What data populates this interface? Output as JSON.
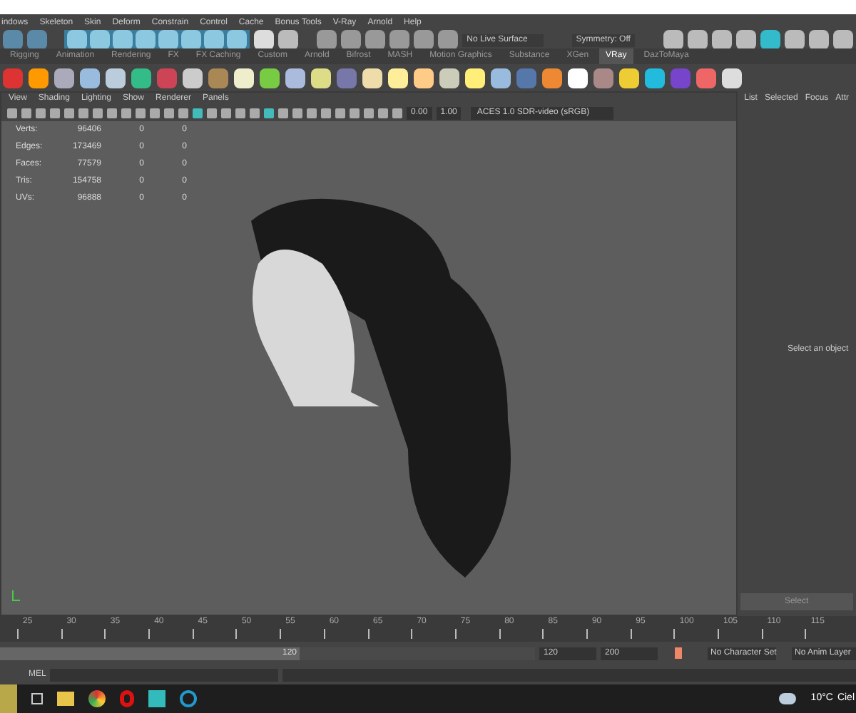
{
  "menu_bar": [
    "indows",
    "Skeleton",
    "Skin",
    "Deform",
    "Constrain",
    "Control",
    "Cache",
    "Bonus Tools",
    "V-Ray",
    "Arnold",
    "Help"
  ],
  "status_line": {
    "live_surface": "No Live Surface",
    "symmetry": "Symmetry: Off"
  },
  "shelf_tabs": [
    {
      "label": "Rigging",
      "selected": false
    },
    {
      "label": "Animation",
      "selected": false
    },
    {
      "label": "Rendering",
      "selected": false
    },
    {
      "label": "FX",
      "selected": false
    },
    {
      "label": "FX Caching",
      "selected": false
    },
    {
      "label": "Custom",
      "selected": false
    },
    {
      "label": "Arnold",
      "selected": false
    },
    {
      "label": "Bifrost",
      "selected": false
    },
    {
      "label": "MASH",
      "selected": false
    },
    {
      "label": "Motion Graphics",
      "selected": false
    },
    {
      "label": "Substance",
      "selected": false
    },
    {
      "label": "XGen",
      "selected": false
    },
    {
      "label": "VRay",
      "selected": true
    },
    {
      "label": "DazToMaya",
      "selected": false
    }
  ],
  "viewport": {
    "menu": [
      "View",
      "Shading",
      "Lighting",
      "Show",
      "Renderer",
      "Panels"
    ],
    "exposure": "0.00",
    "gamma": "1.00",
    "color_space": "ACES 1.0 SDR-video (sRGB)",
    "stats": [
      {
        "label": "Verts:",
        "values": [
          "96406",
          "0",
          "0"
        ]
      },
      {
        "label": "Edges:",
        "values": [
          "173469",
          "0",
          "0"
        ]
      },
      {
        "label": "Faces:",
        "values": [
          "77579",
          "0",
          "0"
        ]
      },
      {
        "label": "Tris:",
        "values": [
          "154758",
          "0",
          "0"
        ]
      },
      {
        "label": "UVs:",
        "values": [
          "96888",
          "0",
          "0"
        ]
      }
    ]
  },
  "channel_box": {
    "tabs": [
      "List",
      "Selected",
      "Focus",
      "Attr"
    ],
    "message": "Select an object",
    "button": "Select"
  },
  "time_slider": {
    "ticks": [
      "25",
      "30",
      "35",
      "40",
      "45",
      "50",
      "55",
      "60",
      "65",
      "70",
      "75",
      "80",
      "85",
      "90",
      "95",
      "100",
      "105",
      "110",
      "115"
    ]
  },
  "range_slider": {
    "level": 0.56,
    "handle": "120",
    "end": "120",
    "max": "200",
    "character_set": "No Character Set",
    "anim_layer": "No Anim Layer"
  },
  "command_line": {
    "language": "MEL"
  },
  "taskbar": {
    "weather": "10°C",
    "weather_text": "Ciel"
  }
}
